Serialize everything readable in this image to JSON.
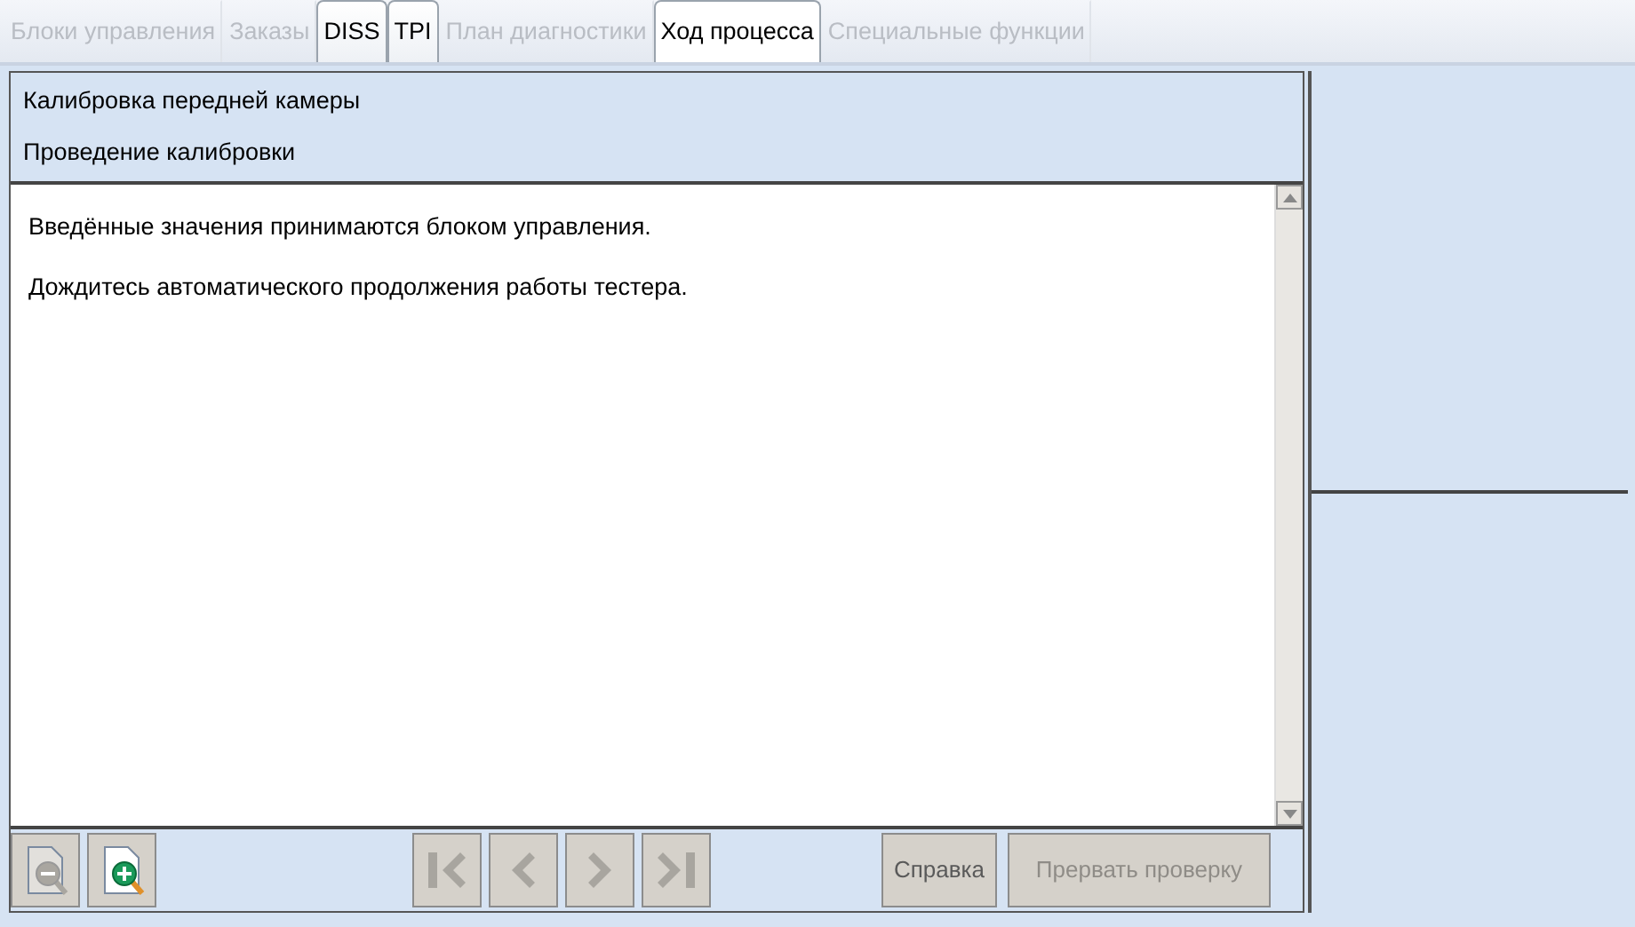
{
  "tabs": [
    {
      "label": "Блоки управления",
      "disabled": true,
      "selected": false
    },
    {
      "label": "Заказы",
      "disabled": true,
      "selected": false
    },
    {
      "label": "DISS",
      "disabled": false,
      "selected": false
    },
    {
      "label": "TPI",
      "disabled": false,
      "selected": false
    },
    {
      "label": "План диагностики",
      "disabled": true,
      "selected": false
    },
    {
      "label": "Ход процесса",
      "disabled": false,
      "selected": true
    },
    {
      "label": "Специальные функции",
      "disabled": true,
      "selected": false
    }
  ],
  "header": {
    "title": "Калибровка передней камеры",
    "subtitle": "Проведение калибровки"
  },
  "messages": [
    "Введённые значения принимаются блоком управления.",
    "Дождитесь автоматического продолжения работы тестера."
  ],
  "toolbar": {
    "zoom": [
      {
        "kind": "zoom-out",
        "disabled": true
      },
      {
        "kind": "zoom-in",
        "disabled": false
      }
    ],
    "navigation": [
      {
        "kind": "first",
        "disabled": true
      },
      {
        "kind": "previous",
        "disabled": true
      },
      {
        "kind": "next",
        "disabled": true
      },
      {
        "kind": "last",
        "disabled": true
      }
    ],
    "buttons": [
      {
        "label": "Справка",
        "disabled": false
      },
      {
        "label": "Прервать проверку",
        "disabled": true
      }
    ]
  }
}
